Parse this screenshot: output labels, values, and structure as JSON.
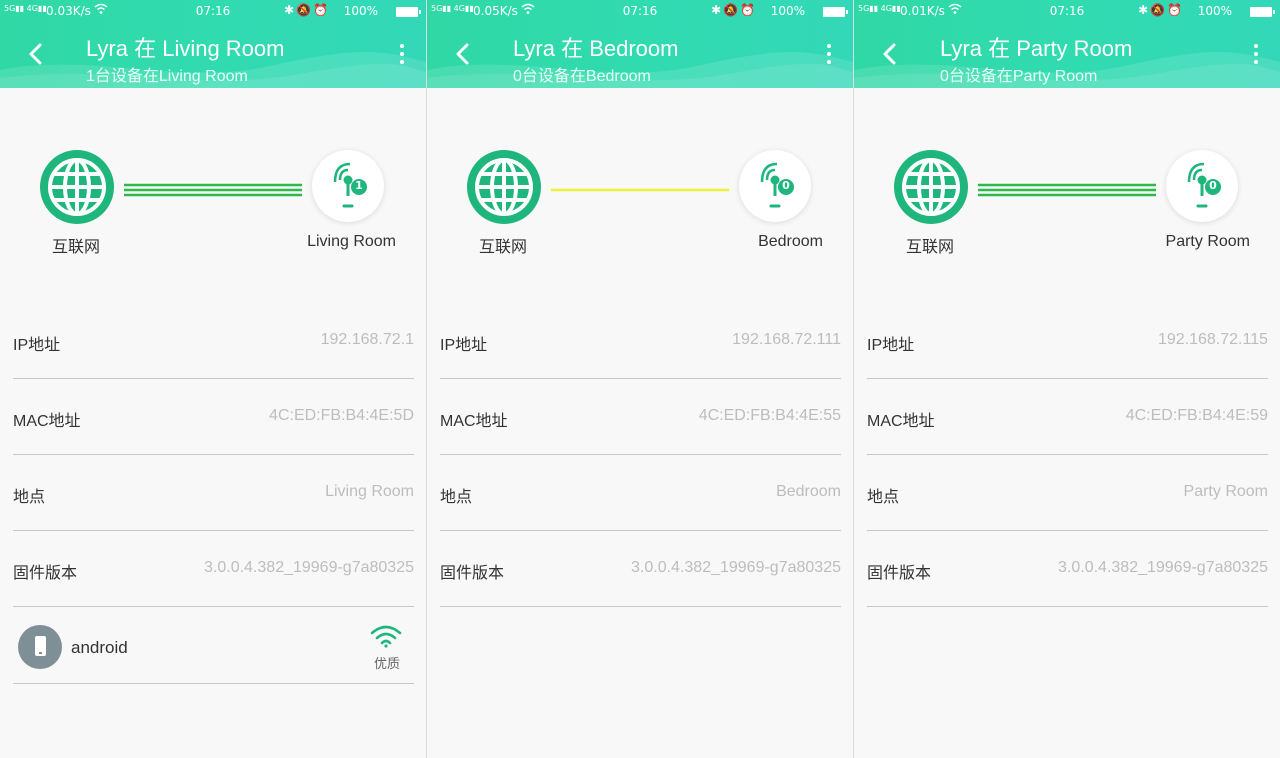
{
  "colors": {
    "header": "#2fd8a4",
    "accent": "#1fb67d",
    "link_good": "#2eb94d",
    "link_weak": "#ecf23a",
    "value_text": "#bdbdbd",
    "divider": "#c8c8c8"
  },
  "screens": [
    {
      "status": {
        "speed": "0.03K/s",
        "time": "07:16",
        "battery": "100%"
      },
      "title": "Lyra 在 Living Room",
      "subtitle": "1台设备在Living Room",
      "internet_label": "互联网",
      "node_label": "Living Room",
      "node_badge": "1",
      "link_quality": "good",
      "rows": [
        {
          "key": "IP地址",
          "value": "192.168.72.1"
        },
        {
          "key": "MAC地址",
          "value": "4C:ED:FB:B4:4E:5D"
        },
        {
          "key": "地点",
          "value": "Living Room"
        },
        {
          "key": "固件版本",
          "value": "3.0.0.4.382_19969-g7a80325"
        }
      ],
      "client": {
        "name": "android",
        "signal_label": "优质",
        "icon": "phone-icon"
      }
    },
    {
      "status": {
        "speed": "0.05K/s",
        "time": "07:16",
        "battery": "100%"
      },
      "title": "Lyra 在 Bedroom",
      "subtitle": "0台设备在Bedroom",
      "internet_label": "互联网",
      "node_label": "Bedroom",
      "node_badge": "0",
      "link_quality": "weak",
      "rows": [
        {
          "key": "IP地址",
          "value": "192.168.72.111"
        },
        {
          "key": "MAC地址",
          "value": "4C:ED:FB:B4:4E:55"
        },
        {
          "key": "地点",
          "value": "Bedroom"
        },
        {
          "key": "固件版本",
          "value": "3.0.0.4.382_19969-g7a80325"
        }
      ]
    },
    {
      "status": {
        "speed": "0.01K/s",
        "time": "07:16",
        "battery": "100%"
      },
      "title": "Lyra 在 Party Room",
      "subtitle": "0台设备在Party Room",
      "internet_label": "互联网",
      "node_label": "Party Room",
      "node_badge": "0",
      "link_quality": "good",
      "rows": [
        {
          "key": "IP地址",
          "value": "192.168.72.115"
        },
        {
          "key": "MAC地址",
          "value": "4C:ED:FB:B4:4E:59"
        },
        {
          "key": "地点",
          "value": "Party Room"
        },
        {
          "key": "固件版本",
          "value": "3.0.0.4.382_19969-g7a80325"
        }
      ]
    }
  ]
}
